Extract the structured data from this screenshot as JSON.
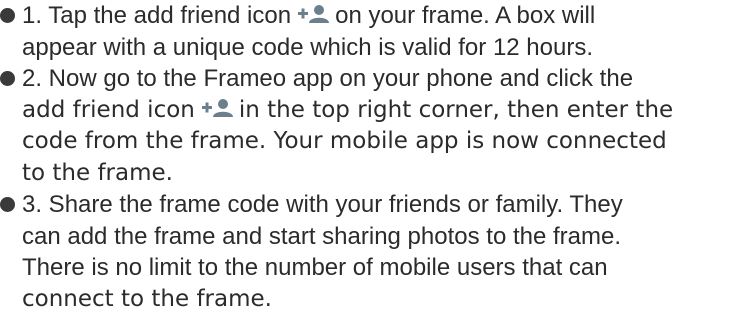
{
  "steps": [
    {
      "l1a": "1. Tap the add friend icon",
      "l1b": "on your frame. A box  will",
      "l2": "appear with a unique code which is valid for 12 hours."
    },
    {
      "l1": "2. Now go to the Frameo app on your phone and click the",
      "l2a": "add friend icon",
      "l2b": "in the top right corner, then enter the",
      "l3": "code from the frame. Your mobile app is now connected",
      "l4": "to the frame."
    },
    {
      "l1": "3. Share the frame code with your friends or family.  They",
      "l2": "can add the frame and start sharing photos to the frame.",
      "l3": "There is no limit to the number of mobile users that can",
      "l4": "connect to the frame."
    }
  ],
  "icons": {
    "add_friend": "add-friend-icon",
    "bullet": "bullet-dot"
  },
  "colors": {
    "icon": "#6b7f8c",
    "text": "#2b2b2b"
  }
}
